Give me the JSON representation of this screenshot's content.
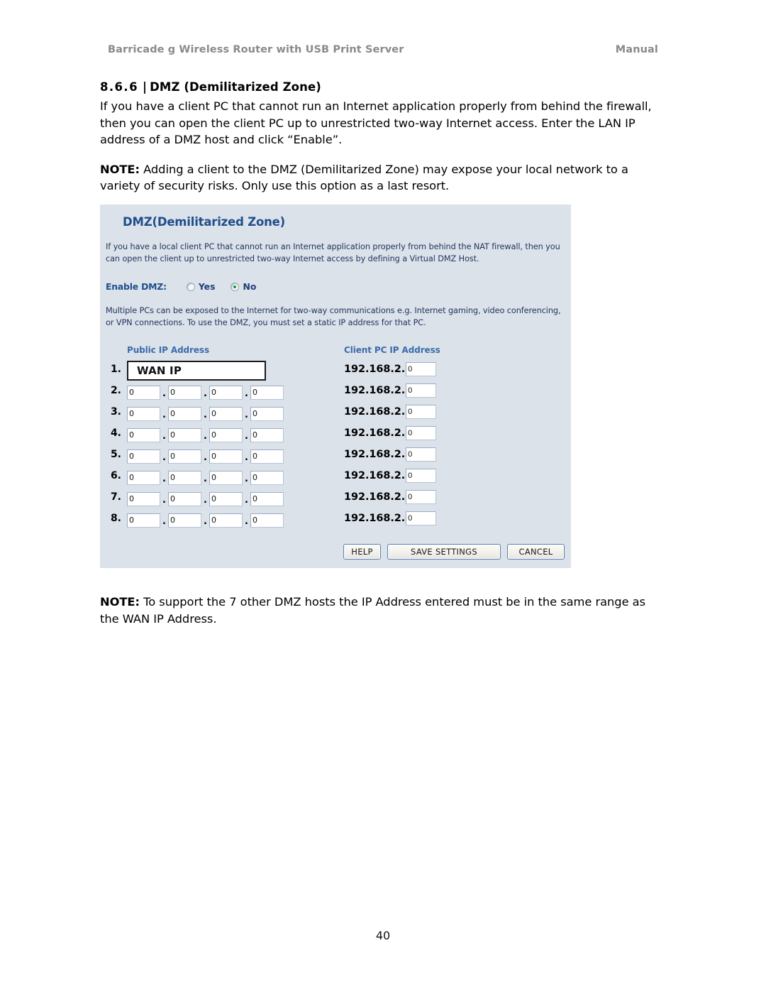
{
  "header": {
    "doc_title": "Barricade g Wireless Router with USB Print Server",
    "doc_kind": "Manual"
  },
  "section": {
    "number": "8.6.6",
    "separator": "|",
    "title": "DMZ (Demilitarized Zone)",
    "heading_full": "8.6.6 | DMZ (Demilitarized Zone)",
    "paragraph": "If you have a client PC that cannot run an Internet application properly from behind the firewall, then you can open the client PC up to unrestricted two-way Internet access. Enter the LAN IP address of a DMZ host and click “Enable”.",
    "note_label": "NOTE:",
    "note_text": " Adding a client to the DMZ (Demilitarized Zone) may expose your local network to a variety of security risks. Only use this option as a last resort."
  },
  "router_ui": {
    "panel_title": "DMZ(Demilitarized Zone)",
    "description": "If you have a local client PC that cannot run an Internet application properly from behind the NAT firewall, then you can open the client up to unrestricted two-way Internet access by defining a Virtual DMZ Host.",
    "enable_label": "Enable DMZ:",
    "radios": [
      {
        "label": "Yes",
        "checked": false
      },
      {
        "label": "No",
        "checked": true
      }
    ],
    "description2": "Multiple PCs can be exposed to the Internet for two-way communications e.g. Internet gaming, video conferencing, or VPN connections.  To use the DMZ, you must set a static IP address for that PC.",
    "columns": {
      "public": "Public IP Address",
      "client": "Client PC IP Address"
    },
    "client_prefix": "192.168.2.",
    "wan_ip_text": "WAN IP",
    "rows": [
      {
        "num": "1.",
        "public_mode": "wanip",
        "public": [
          "",
          "",
          "",
          ""
        ],
        "client": "0"
      },
      {
        "num": "2.",
        "public_mode": "octets",
        "public": [
          "0",
          "0",
          "0",
          "0"
        ],
        "client": "0"
      },
      {
        "num": "3.",
        "public_mode": "octets",
        "public": [
          "0",
          "0",
          "0",
          "0"
        ],
        "client": "0"
      },
      {
        "num": "4.",
        "public_mode": "octets",
        "public": [
          "0",
          "0",
          "0",
          "0"
        ],
        "client": "0"
      },
      {
        "num": "5.",
        "public_mode": "octets",
        "public": [
          "0",
          "0",
          "0",
          "0"
        ],
        "client": "0"
      },
      {
        "num": "6.",
        "public_mode": "octets",
        "public": [
          "0",
          "0",
          "0",
          "0"
        ],
        "client": "0"
      },
      {
        "num": "7.",
        "public_mode": "octets",
        "public": [
          "0",
          "0",
          "0",
          "0"
        ],
        "client": "0"
      },
      {
        "num": "8.",
        "public_mode": "octets",
        "public": [
          "0",
          "0",
          "0",
          "0"
        ],
        "client": "0"
      }
    ],
    "buttons": {
      "help": "HELP",
      "save": "SAVE SETTINGS",
      "cancel": "CANCEL"
    },
    "colors": {
      "panel_bg": "#dce2ea",
      "title_blue": "#1f4e8c",
      "column_header_blue": "#3b6bab",
      "radio_selected_green": "#159a2e",
      "button_border": "#5d7fab"
    }
  },
  "footer_note": {
    "label": "NOTE:",
    "text": " To support the 7 other DMZ hosts the IP Address entered must be in the same range as the WAN IP Address."
  },
  "page_number": "40"
}
